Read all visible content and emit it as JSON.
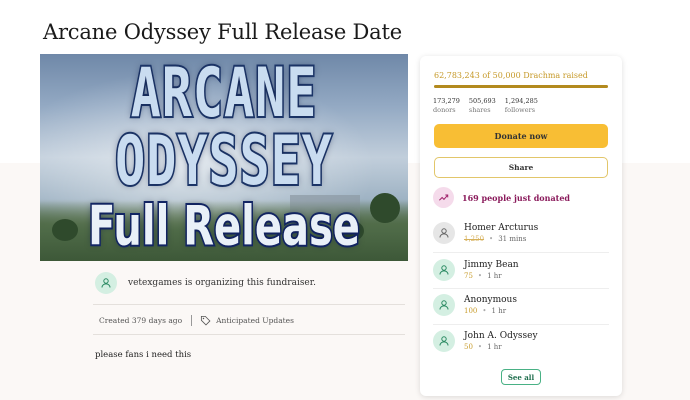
{
  "page": {
    "title": "Arcane Odyssey Full Release Date"
  },
  "hero": {
    "line1": "ARCANE",
    "line2": "ODYSSEY",
    "line3": "Full Release"
  },
  "organizer": {
    "text": "vetexgames is organizing this fundraiser.",
    "icon": "person-icon"
  },
  "meta": {
    "created": "Created 379 days ago",
    "category": "Anticipated Updates",
    "category_icon": "tag-icon"
  },
  "story": {
    "text": "please fans i need this"
  },
  "sidebar": {
    "raised": "62,783,243 of 50,000 Drachma raised",
    "progress_percent": 100,
    "stats": [
      {
        "value": "173,279",
        "label": "donors"
      },
      {
        "value": "505,693",
        "label": "shares"
      },
      {
        "value": "1,294,285",
        "label": "followers"
      }
    ],
    "donate_label": "Donate now",
    "share_label": "Share",
    "recent_text": "169 people just donated",
    "donations": [
      {
        "name": "Homer Arcturus",
        "amount": "1,250",
        "time": "31 mins",
        "struck": true
      },
      {
        "name": "Jimmy Bean",
        "amount": "75",
        "time": "1 hr",
        "struck": false
      },
      {
        "name": "Anonymous",
        "amount": "100",
        "time": "1 hr",
        "struck": false
      },
      {
        "name": "John A. Odyssey",
        "amount": "50",
        "time": "1 hr",
        "struck": false
      }
    ],
    "see_all_label": "See all"
  },
  "colors": {
    "accent_gold": "#f8be34",
    "trend_purple": "#8a1a5b",
    "green": "#49b185"
  }
}
